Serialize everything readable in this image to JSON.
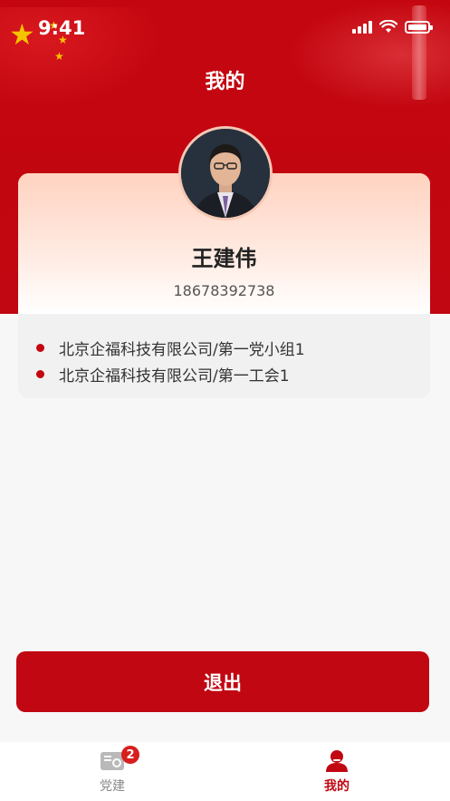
{
  "status_bar": {
    "time": "9:41"
  },
  "header": {
    "title": "我的"
  },
  "profile": {
    "name": "王建伟",
    "phone": "18678392738",
    "organizations": [
      "北京企福科技有限公司/第一党小组1",
      "北京企福科技有限公司/第一工会1"
    ]
  },
  "actions": {
    "logout_label": "退出"
  },
  "tabbar": {
    "tabs": [
      {
        "label": "党建",
        "badge": "2",
        "icon": "party-building-icon",
        "active": false
      },
      {
        "label": "我的",
        "icon": "user-icon",
        "active": true
      }
    ]
  },
  "colors": {
    "primary_red": "#c10711",
    "badge_red": "#d81e1e",
    "inactive_tab": "#8a8a8a",
    "active_tab": "#c10711"
  }
}
